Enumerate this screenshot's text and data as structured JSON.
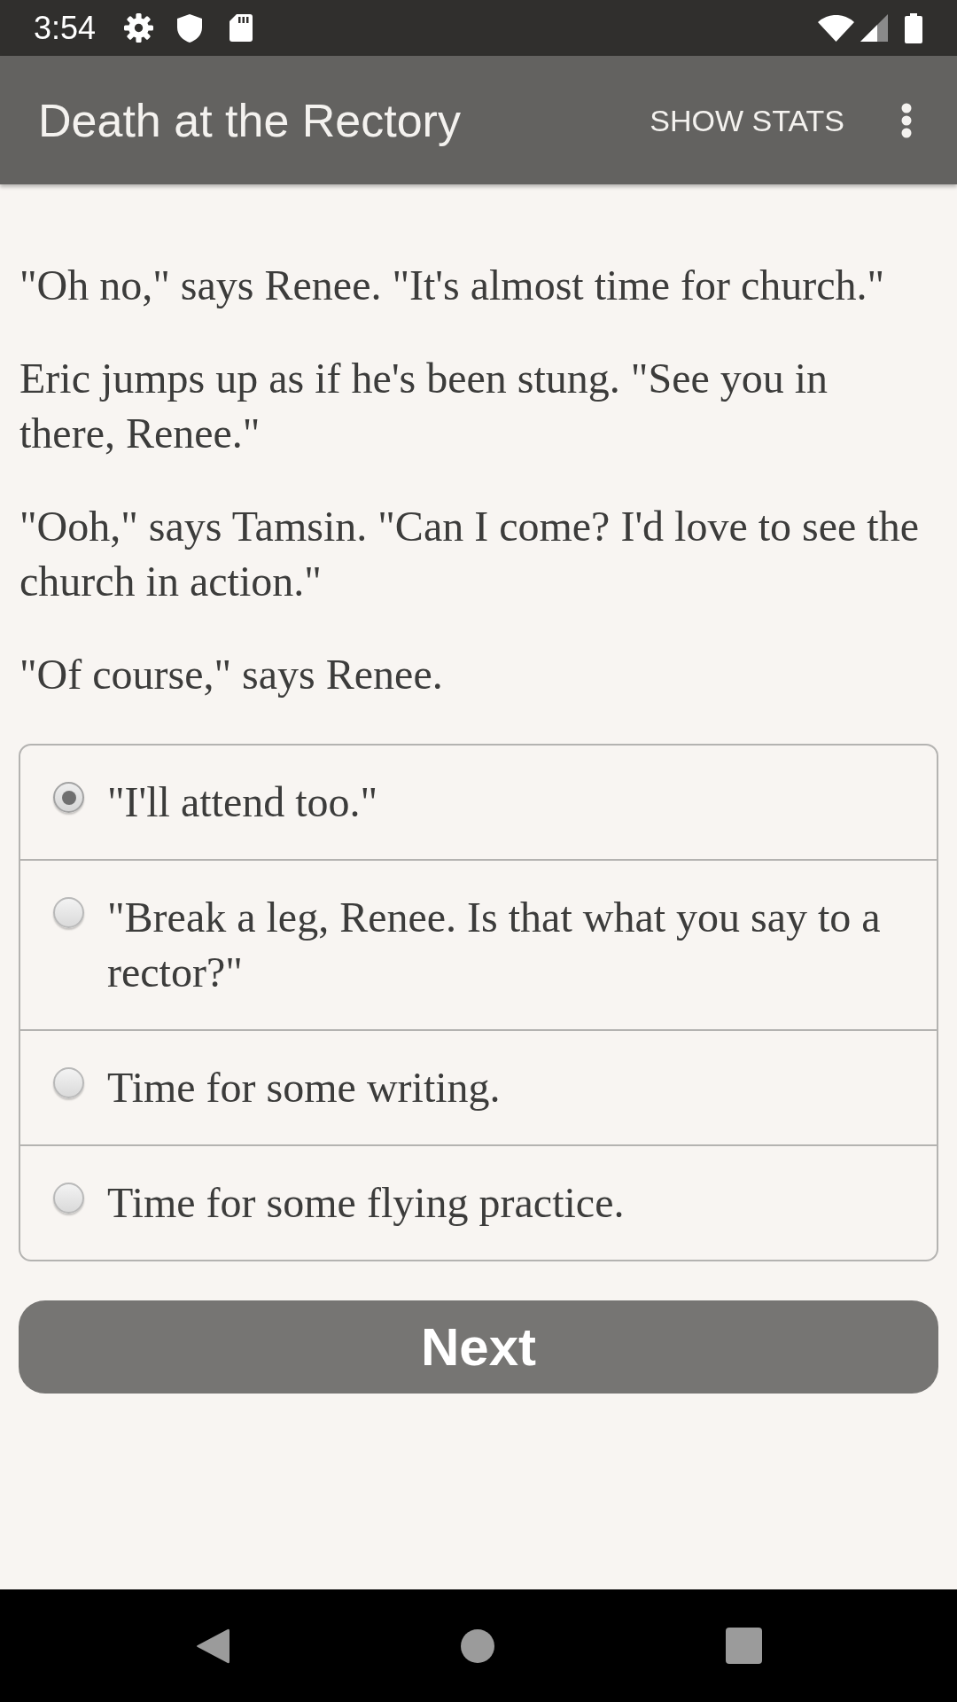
{
  "status_bar": {
    "time": "3:54"
  },
  "app_bar": {
    "title": "Death at the Rectory",
    "action": "SHOW STATS"
  },
  "passage": [
    "\"Oh no,\" says Renee. \"It's almost time for church.\"",
    "Eric jumps up as if he's been stung. \"See you in there, Renee.\"",
    "\"Ooh,\" says Tamsin. \"Can I come? I'd love to see the church in action.\"",
    "\"Of course,\" says Renee."
  ],
  "choices": [
    {
      "label": "\"I'll attend too.\"",
      "selected": true
    },
    {
      "label": "\"Break a leg, Renee. Is that what you say to a rector?\"",
      "selected": false
    },
    {
      "label": "Time for some writing.",
      "selected": false
    },
    {
      "label": "Time for some flying practice.",
      "selected": false
    }
  ],
  "next_button": {
    "label": "Next"
  }
}
